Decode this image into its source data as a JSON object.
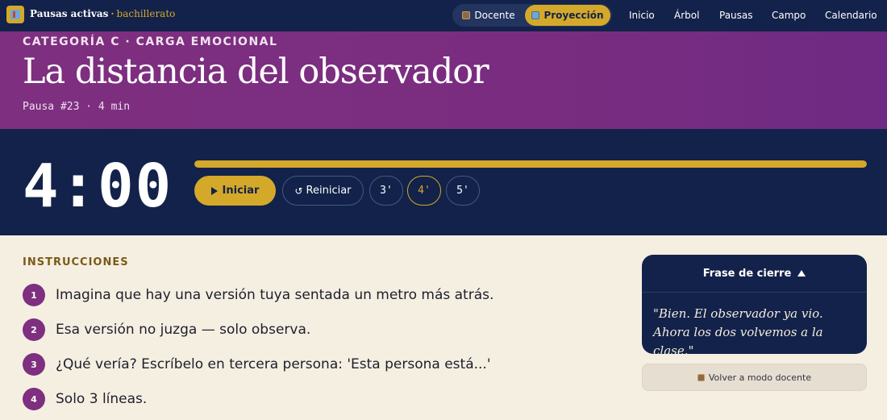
{
  "nav": {
    "brand_main": "Pausas activas",
    "brand_sep": "·",
    "brand_sub": "bachillerato",
    "mode_docente": "Docente",
    "mode_proyeccion": "Proyección",
    "links": [
      "Inicio",
      "Árbol",
      "Pausas",
      "Campo",
      "Calendario"
    ]
  },
  "hero": {
    "category": "CATEGORÍA C · CARGA EMOCIONAL",
    "title": "La distancia del observador",
    "meta": "Pausa #23 · 4 min"
  },
  "timer": {
    "display": "4:00",
    "progress_fraction": 1.0,
    "start_label": "Iniciar",
    "reset_label": "Reiniciar",
    "options": [
      "3'",
      "4'",
      "5'"
    ],
    "active_option": "4'"
  },
  "instructions": {
    "label": "INSTRUCCIONES",
    "steps": [
      {
        "num": "1",
        "text": "Imagina que hay una versión tuya sentada un metro más atrás."
      },
      {
        "num": "2",
        "text": "Esa versión no juzga — solo observa."
      },
      {
        "num": "3",
        "text": "¿Qué vería? Escríbelo en tercera persona: 'Esta persona está...'"
      },
      {
        "num": "4",
        "text": "Solo 3 líneas."
      }
    ]
  },
  "closing": {
    "heading": "Frase de cierre",
    "quote": "\"Bien. El observador ya vio. Ahora los dos volvemos a la clase.\""
  },
  "back_button": "Volver a modo docente",
  "colors": {
    "navy": "#13224a",
    "purple": "#7e2f7f",
    "gold": "#d4a92a",
    "cream": "#f5efe2"
  }
}
